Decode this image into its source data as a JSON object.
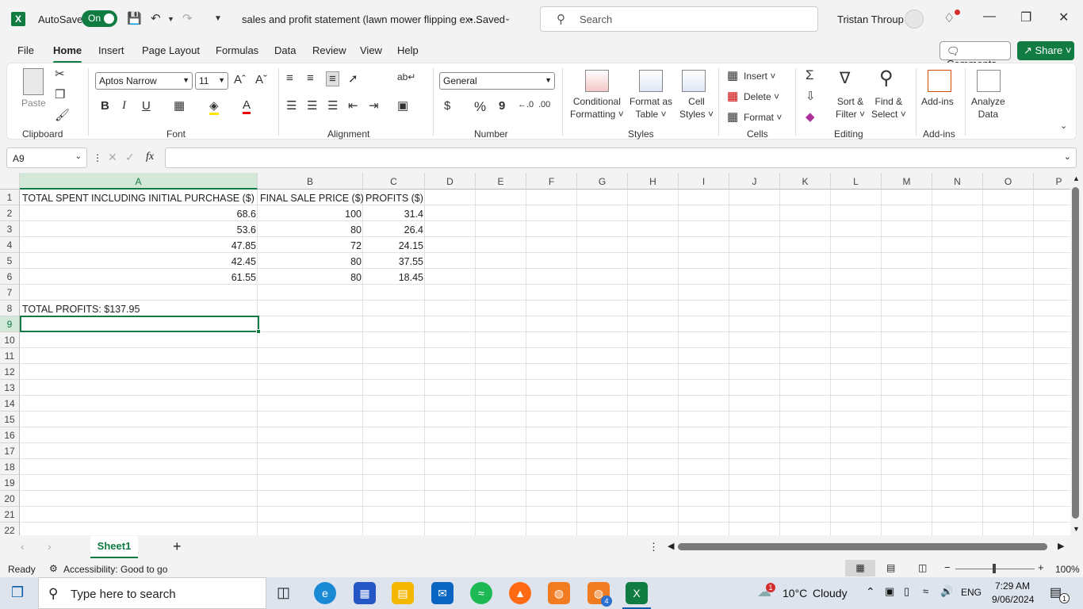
{
  "titlebar": {
    "app_letter": "X",
    "autosave_label": "AutoSave",
    "autosave_state": "On",
    "doc_title": "sales and profit statement (lawn mower flipping ex...",
    "saved": "• Saved",
    "search_placeholder": "Search",
    "user_name": "Tristan Throup"
  },
  "menu": {
    "tabs": [
      "File",
      "Home",
      "Insert",
      "Page Layout",
      "Formulas",
      "Data",
      "Review",
      "View",
      "Help"
    ],
    "comments": "Comments",
    "share": "Share"
  },
  "ribbon": {
    "clipboard": {
      "paste": "Paste",
      "label": "Clipboard"
    },
    "font": {
      "name": "Aptos Narrow",
      "size": "11",
      "label": "Font",
      "bold": "B",
      "italic": "I",
      "underline": "U"
    },
    "alignment": {
      "label": "Alignment"
    },
    "number": {
      "format": "General",
      "label": "Number",
      "currency": "$",
      "percent": "%",
      "comma": "9"
    },
    "styles": {
      "conditional": "Conditional",
      "conditional2": "Formatting",
      "format_table": "Format as",
      "format_table2": "Table",
      "cell_styles": "Cell",
      "cell_styles2": "Styles",
      "label": "Styles"
    },
    "cells": {
      "insert": "Insert",
      "delete": "Delete",
      "format": "Format",
      "label": "Cells"
    },
    "editing": {
      "sort": "Sort &",
      "sort2": "Filter",
      "find": "Find &",
      "find2": "Select",
      "label": "Editing"
    },
    "addins": {
      "addins": "Add-ins",
      "label": "Add-ins"
    },
    "analyze": {
      "analyze": "Analyze",
      "analyze2": "Data"
    }
  },
  "formula_bar": {
    "name_box": "A9",
    "fx": "fx",
    "formula": ""
  },
  "grid": {
    "columns": [
      "A",
      "B",
      "C",
      "D",
      "E",
      "F",
      "G",
      "H",
      "I",
      "J",
      "K",
      "L",
      "M",
      "N",
      "O",
      "P"
    ],
    "rows": [
      "1",
      "2",
      "3",
      "4",
      "5",
      "6",
      "7",
      "8",
      "9",
      "10",
      "11",
      "12",
      "13",
      "14",
      "15",
      "16",
      "17",
      "18",
      "19",
      "20",
      "21",
      "22"
    ],
    "active_column": "A",
    "active_row": "9",
    "cells": {
      "A1": "TOTAL SPENT INCLUDING INITIAL PURCHASE ($)",
      "B1": "FINAL SALE PRICE ($)",
      "C1": "PROFITS ($)",
      "A2": "68.6",
      "B2": "100",
      "C2": "31.4",
      "A3": "53.6",
      "B3": "80",
      "C3": "26.4",
      "A4": "47.85",
      "B4": "72",
      "C4": "24.15",
      "A5": "42.45",
      "B5": "80",
      "C5": "37.55",
      "A6": "61.55",
      "B6": "80",
      "C6": "18.45",
      "A8": "TOTAL PROFITS: $137.95"
    }
  },
  "sheets": {
    "active": "Sheet1",
    "add": "+"
  },
  "status": {
    "ready": "Ready",
    "accessibility": "Accessibility: Good to go",
    "zoom": "100%"
  },
  "taskbar": {
    "search_placeholder": "Type here to search",
    "weather_temp": "10°C",
    "weather_desc": "Cloudy",
    "weather_badge": "1",
    "lang": "ENG",
    "time": "7:29 AM",
    "date": "9/06/2024",
    "notif_count": "1",
    "app_badge": "4"
  }
}
